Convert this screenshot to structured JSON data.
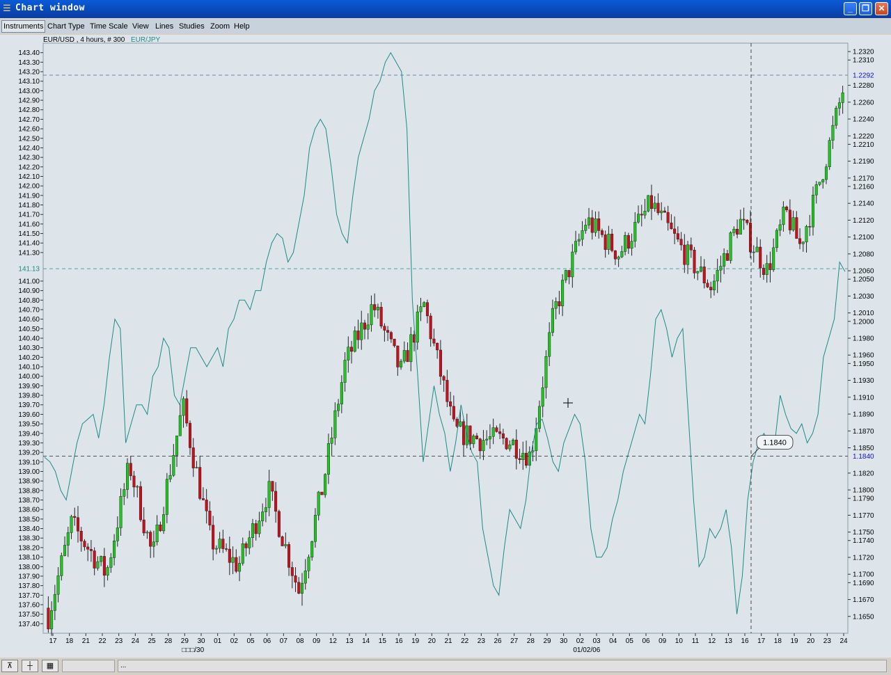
{
  "window": {
    "title": "Chart window",
    "icon": "app-icon",
    "controls": [
      "minimize-icon",
      "maximize-icon",
      "close-icon"
    ]
  },
  "menu": [
    "Instruments",
    "Chart Type",
    "Time Scale",
    "View",
    "Lines",
    "Studies",
    "Zoom",
    "Help"
  ],
  "legend": {
    "primary": "EUR/USD , 4 hours, # 300",
    "secondary": "EUR/JPY"
  },
  "colors": {
    "background": "#dde5ea",
    "bull_candle": "#22c422",
    "bear_candle": "#c8101c",
    "wick": "#222222",
    "secondary_line": "#1e8a86",
    "current_price_label": "#1010cc"
  },
  "statusbar": {
    "field_text": "...",
    "buttons": [
      "pin-icon",
      "crosshair-icon",
      "chart-tool-icon"
    ]
  },
  "chart_data": {
    "type": "line",
    "title": "",
    "series": [
      {
        "name": "EUR/USD , 4 hours, # 300",
        "kind": "candlestick",
        "axis": "right",
        "bars": 300
      },
      {
        "name": "EUR/JPY",
        "kind": "line",
        "axis": "left"
      }
    ],
    "left_axis": {
      "ylim": [
        137.3,
        143.5
      ],
      "ticks": [
        "137.40",
        "137.50",
        "137.60",
        "137.70",
        "137.80",
        "137.90",
        "138.00",
        "138.10",
        "138.20",
        "138.30",
        "138.40",
        "138.50",
        "138.60",
        "138.70",
        "138.80",
        "138.90",
        "139.00",
        "139.10",
        "139.20",
        "139.30",
        "139.40",
        "139.50",
        "139.60",
        "139.70",
        "139.80",
        "139.90",
        "140.00",
        "140.10",
        "140.20",
        "140.30",
        "140.40",
        "140.50",
        "140.60",
        "140.70",
        "140.80",
        "140.90",
        "141.00",
        "141.30",
        "141.40",
        "141.50",
        "141.60",
        "141.70",
        "141.80",
        "141.90",
        "142.00",
        "142.10",
        "142.20",
        "142.30",
        "142.40",
        "142.50",
        "142.60",
        "142.70",
        "142.80",
        "142.90",
        "143.00",
        "143.10",
        "143.20",
        "143.30",
        "143.40"
      ],
      "current_value": "141.13"
    },
    "right_axis": {
      "ylim": [
        1.163,
        1.233
      ],
      "ticks": [
        "1.1650",
        "1.1670",
        "1.1690",
        "1.1700",
        "1.1720",
        "1.1740",
        "1.1750",
        "1.1770",
        "1.1790",
        "1.1800",
        "1.1820",
        "1.1850",
        "1.1870",
        "1.1890",
        "1.1910",
        "1.1930",
        "1.1950",
        "1.1960",
        "1.1980",
        "1.2000",
        "1.2010",
        "1.2030",
        "1.2050",
        "1.2060",
        "1.2080",
        "1.2100",
        "1.2120",
        "1.2140",
        "1.2160",
        "1.2170",
        "1.2190",
        "1.2210",
        "1.2220",
        "1.2240",
        "1.2260",
        "1.2280",
        "1.2310",
        "1.2320"
      ],
      "current_value": "1.2292",
      "crosshair_value": "1.1840"
    },
    "x_ticks": [
      "17",
      "18",
      "21",
      "22",
      "23",
      "24",
      "25",
      "28",
      "29",
      "30",
      "01",
      "02",
      "05",
      "06",
      "07",
      "08",
      "09",
      "12",
      "13",
      "14",
      "15",
      "16",
      "19",
      "20",
      "21",
      "22",
      "23",
      "26",
      "27",
      "28",
      "29",
      "30",
      "02",
      "03",
      "04",
      "05",
      "06",
      "09",
      "10",
      "11",
      "12",
      "13",
      "16",
      "17",
      "18",
      "19",
      "20",
      "23",
      "24"
    ],
    "x_sublabels": [
      "□□□/30",
      "01/02/06"
    ],
    "crosshair_tooltip": "1.1840",
    "secondary_line_values": [
      139.15,
      139.1,
      139.0,
      138.8,
      138.7,
      139.0,
      139.3,
      139.5,
      139.55,
      139.6,
      139.35,
      139.7,
      140.2,
      140.6,
      140.5,
      139.3,
      139.5,
      139.7,
      139.7,
      139.6,
      140.0,
      140.1,
      140.4,
      140.3,
      139.8,
      139.7,
      140.0,
      140.3,
      140.3,
      140.2,
      140.1,
      140.2,
      140.3,
      140.1,
      140.5,
      140.6,
      140.8,
      140.8,
      140.7,
      140.9,
      140.9,
      141.2,
      141.4,
      141.5,
      141.45,
      141.2,
      141.3,
      141.6,
      141.9,
      142.4,
      142.6,
      142.7,
      142.6,
      142.2,
      141.7,
      141.5,
      141.4,
      141.9,
      142.3,
      142.5,
      142.7,
      143.0,
      143.1,
      143.3,
      143.4,
      143.3,
      143.2,
      142.6,
      140.8,
      140.0,
      139.1,
      139.5,
      139.9,
      139.6,
      139.4,
      139.0,
      139.3,
      139.7,
      139.4,
      139.2,
      139.1,
      138.4,
      138.1,
      137.8,
      137.7,
      138.2,
      138.6,
      138.5,
      138.4,
      138.7,
      139.2,
      139.5,
      139.55,
      139.35,
      139.1,
      139.0,
      139.3,
      139.45,
      139.6,
      139.5,
      139.1,
      138.4,
      138.1,
      138.1,
      138.2,
      138.5,
      138.7,
      139.0,
      139.2,
      139.4,
      139.6,
      139.5,
      140.0,
      140.6,
      140.7,
      140.5,
      140.2,
      140.4,
      140.5,
      139.6,
      138.7,
      138.0,
      138.1,
      138.4,
      138.3,
      138.4,
      138.6,
      138.2,
      137.5,
      137.9,
      138.7,
      139.1,
      139.3,
      139.4,
      139.3,
      139.3,
      139.8,
      139.6,
      139.45,
      139.4,
      139.5,
      139.3,
      139.4,
      139.6,
      140.2,
      140.4,
      140.6,
      141.2,
      141.1
    ]
  }
}
